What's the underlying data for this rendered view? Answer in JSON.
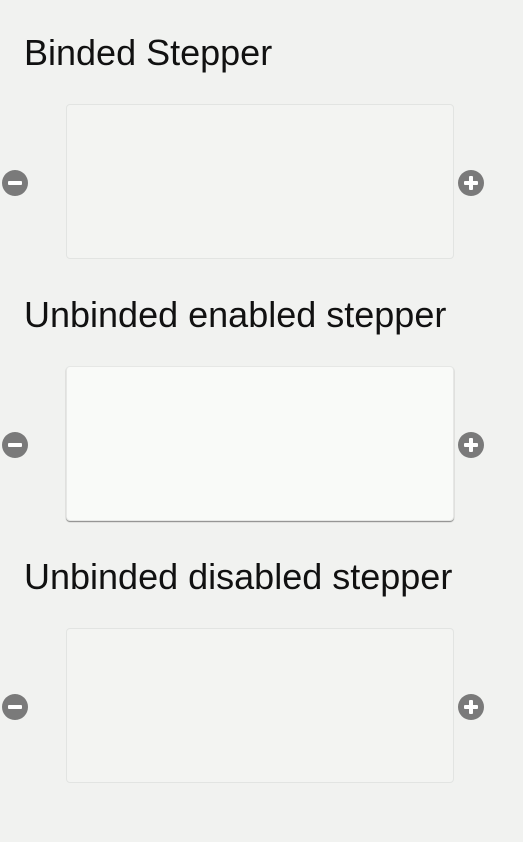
{
  "sections": [
    {
      "title": "Binded Stepper",
      "state": "binded",
      "value": ""
    },
    {
      "title": "Unbinded enabled stepper",
      "state": "enabled",
      "value": ""
    },
    {
      "title": "Unbinded disabled stepper",
      "state": "disabled",
      "value": ""
    }
  ],
  "icons": {
    "decrement": "minus-circle-icon",
    "increment": "plus-circle-icon"
  },
  "colors": {
    "background": "#f1f2f0",
    "button": "#7a7a7a",
    "text": "#111111"
  }
}
